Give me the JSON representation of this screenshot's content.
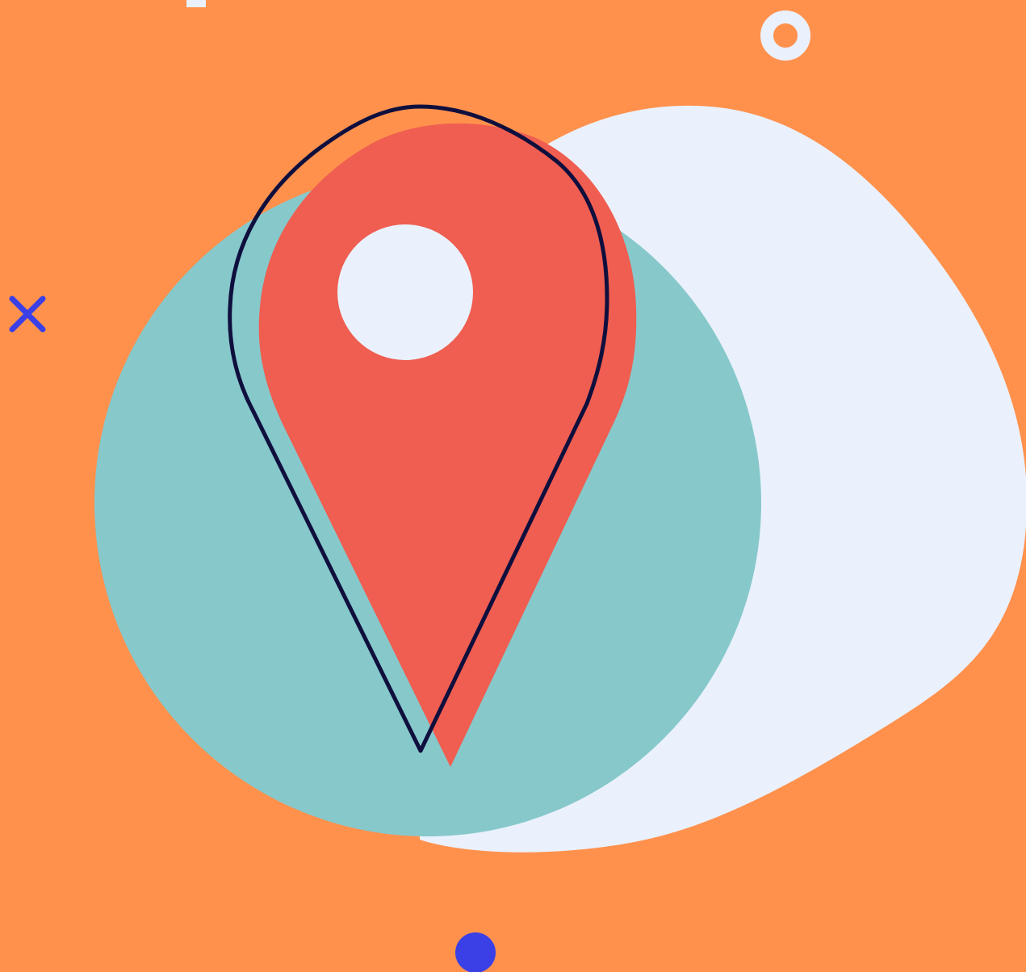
{
  "illustration": {
    "subject": "location-pin-icon",
    "colors": {
      "background": "#FF914D",
      "blob": "#EAF1FC",
      "teal_circle": "#87C8CB",
      "pin_fill": "#EF5E50",
      "pin_outline": "#0F0F3E",
      "pin_hole": "#EAF1FC",
      "accent_blue": "#3A40E6",
      "ring": "#EAF1FC"
    },
    "decorations": [
      "ring-icon",
      "cross-icon",
      "dot-icon",
      "blob-shape",
      "circle-shape"
    ]
  }
}
